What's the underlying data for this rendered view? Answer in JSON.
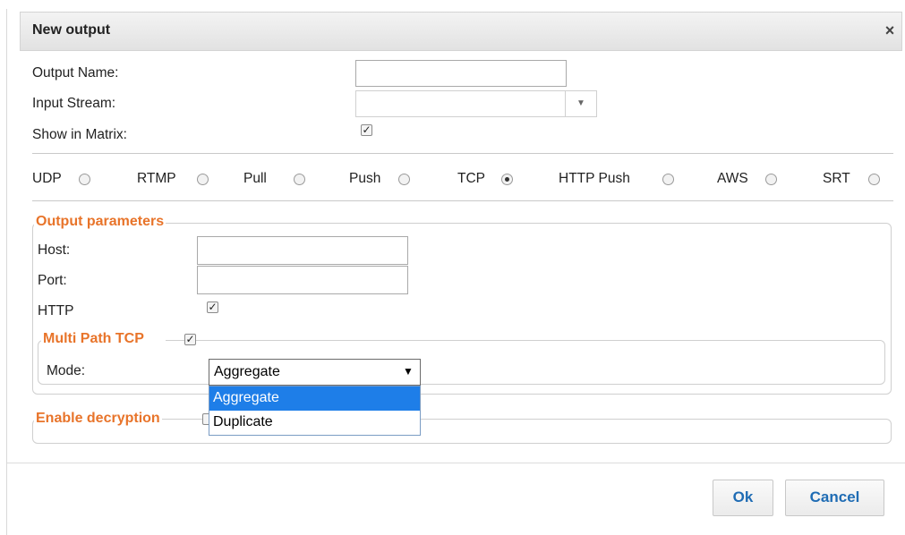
{
  "dialog": {
    "title": "New output",
    "close_icon": "×"
  },
  "form": {
    "output_name_label": "Output Name:",
    "output_name_value": "",
    "input_stream_label": "Input Stream:",
    "input_stream_value": "",
    "show_in_matrix_label": "Show in Matrix:",
    "show_in_matrix_checked": true
  },
  "protocols": [
    {
      "label": "UDP",
      "selected": false
    },
    {
      "label": "RTMP",
      "selected": false
    },
    {
      "label": "Pull",
      "selected": false
    },
    {
      "label": "Push",
      "selected": false
    },
    {
      "label": "TCP",
      "selected": true
    },
    {
      "label": "HTTP Push",
      "selected": false
    },
    {
      "label": "AWS",
      "selected": false
    },
    {
      "label": "SRT",
      "selected": false
    }
  ],
  "output_parameters": {
    "legend": "Output parameters",
    "host_label": "Host:",
    "host_value": "",
    "port_label": "Port:",
    "port_value": "",
    "http_label": "HTTP",
    "http_checked": true
  },
  "multipath": {
    "legend": "Multi Path TCP",
    "checked": true,
    "mode_label": "Mode:",
    "mode_value": "Aggregate",
    "mode_arrow": "▼",
    "options": [
      "Aggregate",
      "Duplicate"
    ],
    "highlighted_option": "Aggregate"
  },
  "decryption": {
    "legend": "Enable decryption"
  },
  "buttons": {
    "ok": "Ok",
    "cancel": "Cancel"
  },
  "colors": {
    "legend_orange": "#e8742a",
    "button_text_blue": "#1f6cb4",
    "dropdown_highlight": "#1e7ee8"
  }
}
